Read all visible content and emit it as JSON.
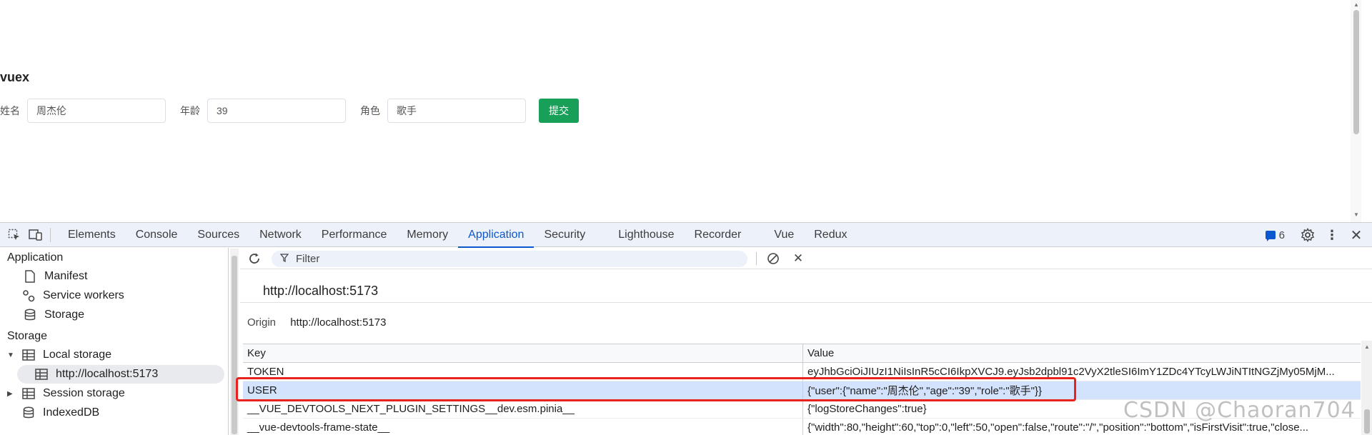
{
  "app": {
    "title": "vuex",
    "form": {
      "name_label": "姓名",
      "name_value": "周杰伦",
      "age_label": "年龄",
      "age_value": "39",
      "role_label": "角色",
      "role_value": "歌手",
      "submit_label": "提交"
    }
  },
  "devtools": {
    "tabs": [
      "Elements",
      "Console",
      "Sources",
      "Network",
      "Performance",
      "Memory",
      "Application",
      "Security",
      "Lighthouse",
      "Recorder",
      "Vue",
      "Redux"
    ],
    "active_tab": "Application",
    "issues_count": "6",
    "accent_color": "#0b57d0"
  },
  "sidebar": {
    "application_heading": "Application",
    "application_items": [
      {
        "label": "Manifest",
        "icon": "file-icon"
      },
      {
        "label": "Service workers",
        "icon": "gears-icon"
      },
      {
        "label": "Storage",
        "icon": "database-icon"
      }
    ],
    "storage_heading": "Storage",
    "local_storage": "Local storage",
    "local_storage_origin": "http://localhost:5173",
    "session_storage": "Session storage",
    "indexeddb": "IndexedDB"
  },
  "panel": {
    "filter_placeholder": "Filter",
    "origin_title": "http://localhost:5173",
    "origin_key": "Origin",
    "origin_value": "http://localhost:5173",
    "columns": {
      "key": "Key",
      "value": "Value"
    },
    "rows": [
      {
        "key": "TOKEN",
        "value": "eyJhbGciOiJIUzI1NiIsInR5cCI6IkpXVCJ9.eyJsb2dpbl91c2VyX2tleSI6ImY1ZDc4YTcyLWJiNTItNGZjMy05MjM..."
      },
      {
        "key": "USER",
        "value": "{\"user\":{\"name\":\"周杰伦\",\"age\":\"39\",\"role\":\"歌手\"}}"
      },
      {
        "key": "__VUE_DEVTOOLS_NEXT_PLUGIN_SETTINGS__dev.esm.pinia__",
        "value": "{\"logStoreChanges\":true}"
      },
      {
        "key": "__vue-devtools-frame-state__",
        "value": "{\"width\":80,\"height\":60,\"top\":0,\"left\":50,\"open\":false,\"route\":\"/\",\"position\":\"bottom\",\"isFirstVisit\":true,\"close..."
      }
    ]
  },
  "watermark": "CSDN @Chaoran704"
}
